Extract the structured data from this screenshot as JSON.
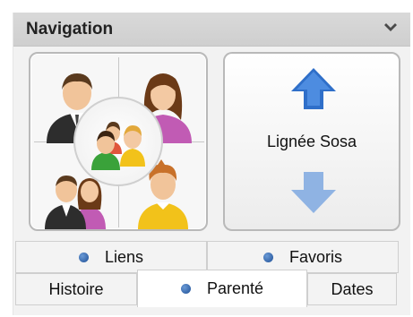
{
  "panel": {
    "title": "Navigation",
    "collapse_icon": "chevron-down-icon"
  },
  "buttons": {
    "family_icon": "family-group-icon",
    "sosa_label": "Lignée Sosa",
    "sosa_up_icon": "arrow-up-icon",
    "sosa_down_icon": "arrow-down-icon"
  },
  "tabs": {
    "liens": "Liens",
    "favoris": "Favoris",
    "histoire": "Histoire",
    "parente": "Parenté",
    "dates": "Dates",
    "active": "Parenté"
  },
  "colors": {
    "header_bg": "#d4d4d4",
    "arrow_blue": "#2f6fc9",
    "arrow_blue_faded": "#8fb3e3",
    "tab_dot": "#1f4f96"
  }
}
